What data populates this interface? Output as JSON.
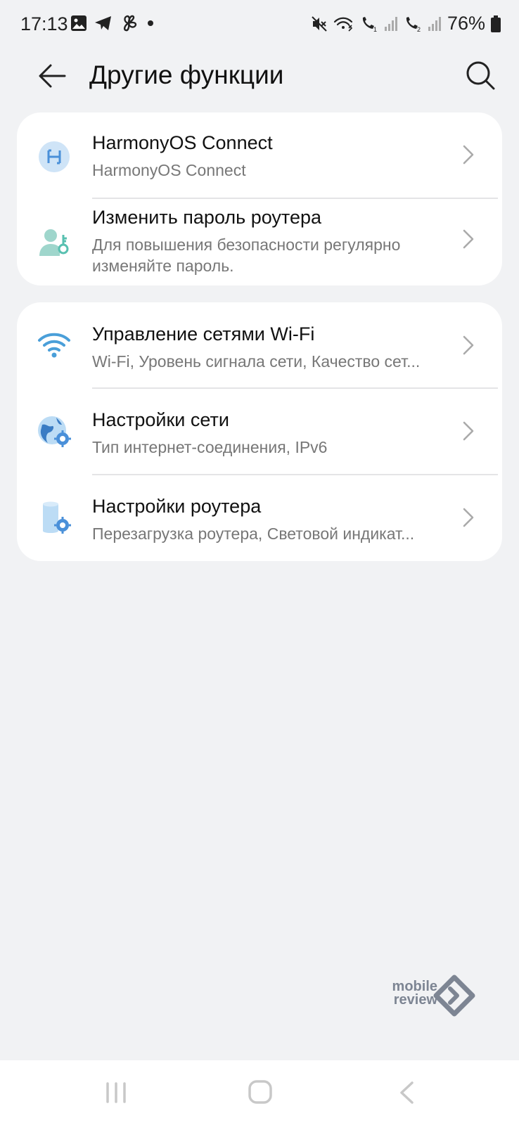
{
  "status_bar": {
    "time": "17:13",
    "battery": "76%",
    "left_icons": [
      "gallery-icon",
      "telegram-icon",
      "fan-icon",
      "dot-icon"
    ],
    "right_icons": [
      "mute-icon",
      "wifi-call-icon",
      "sim1-call-icon",
      "sim1-signal-icon",
      "sim2-call-icon",
      "sim2-signal-icon",
      "battery-icon"
    ]
  },
  "header": {
    "title": "Другие функции"
  },
  "groups": [
    {
      "items": [
        {
          "title": "HarmonyOS Connect",
          "subtitle": "HarmonyOS Connect",
          "icon": "harmonyos-icon"
        },
        {
          "title": "Изменить пароль роутера",
          "subtitle": "Для повышения безопасности регулярно изменяйте пароль.",
          "icon": "user-key-icon"
        }
      ]
    },
    {
      "items": [
        {
          "title": "Управление сетями Wi-Fi",
          "subtitle": "Wi-Fi, Уровень сигнала сети, Качество сет...",
          "icon": "wifi-icon"
        },
        {
          "title": "Настройки сети",
          "subtitle": "Тип интернет-соединения, IPv6",
          "icon": "globe-gear-icon"
        },
        {
          "title": "Настройки роутера",
          "subtitle": "Перезагрузка роутера, Световой индикат...",
          "icon": "router-gear-icon"
        }
      ]
    }
  ],
  "watermark": {
    "line1": "mobile",
    "line2": "review"
  },
  "navbar": {
    "icons": [
      "recent-apps-icon",
      "home-icon",
      "back-nav-icon"
    ]
  },
  "colors": {
    "background": "#f1f2f4",
    "card": "#ffffff",
    "icon_blue": "#4a90d9",
    "icon_teal": "#58c0b0"
  }
}
